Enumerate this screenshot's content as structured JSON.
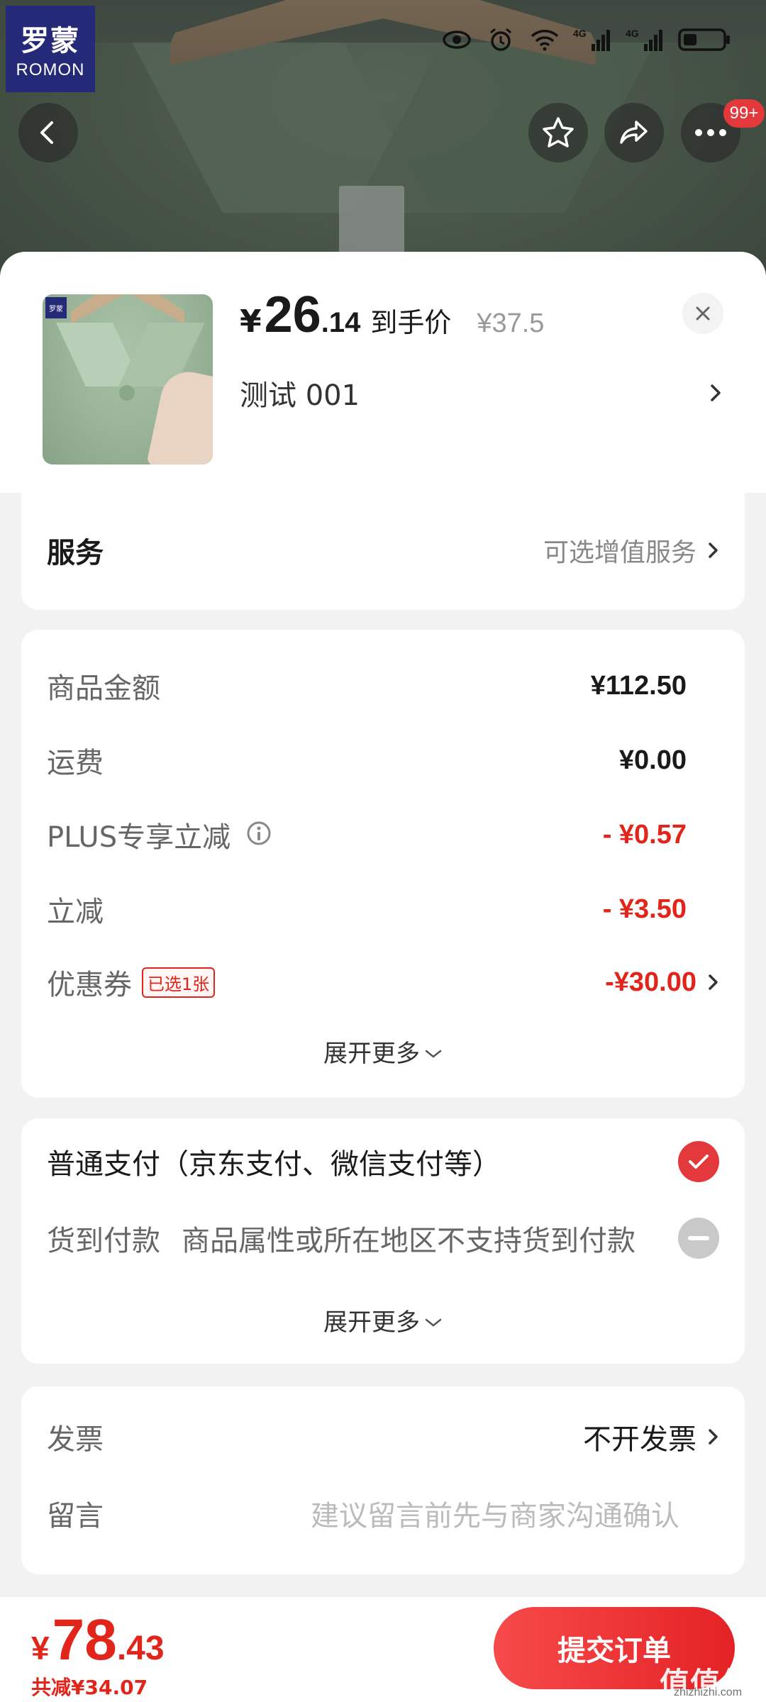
{
  "brand": {
    "logo_cn": "罗蒙",
    "logo_en": "ROMON"
  },
  "status_bar": {
    "icons": [
      "eye-icon",
      "alarm-icon",
      "wifi-icon",
      "signal-4g-icon",
      "signal-4g-icon",
      "battery-icon"
    ],
    "net1": "4G",
    "net2": "4G"
  },
  "top_nav": {
    "notification_badge": "99+"
  },
  "product": {
    "price_symbol": "¥",
    "price_int": "26",
    "price_dec": ".14",
    "price_label": "到手价",
    "original_price": "¥37.5",
    "spec": "测试  001"
  },
  "service": {
    "label": "服务",
    "hint": "可选增值服务"
  },
  "fees": {
    "rows": [
      {
        "label": "商品金额",
        "value": "¥112.50"
      },
      {
        "label": "运费",
        "value": "¥0.00"
      },
      {
        "label": "PLUS专享立减",
        "value": "- ¥0.57"
      },
      {
        "label": "立减",
        "value": "- ¥3.50"
      },
      {
        "label": "优惠券",
        "tag": "已选1张",
        "value": "-¥30.00"
      }
    ],
    "expand": "展开更多"
  },
  "payment": {
    "standard": "普通支付（京东支付、微信支付等）",
    "cod_label": "货到付款",
    "cod_hint": "商品属性或所在地区不支持货到付款",
    "expand": "展开更多"
  },
  "extra": {
    "invoice_label": "发票",
    "invoice_value": "不开发票",
    "note_label": "留言",
    "note_placeholder": "建议留言前先与商家沟通确认"
  },
  "bottom": {
    "symbol": "¥",
    "total_int": "78",
    "total_dec": ".43",
    "saved": "共减¥34.07",
    "submit": "提交订单"
  },
  "watermark": {
    "main": "值值值",
    "sub": "zhizhizhi.com"
  },
  "colors": {
    "accent_red": "#e1251b",
    "button_red": "#e42225",
    "brand_navy": "#252a78"
  }
}
